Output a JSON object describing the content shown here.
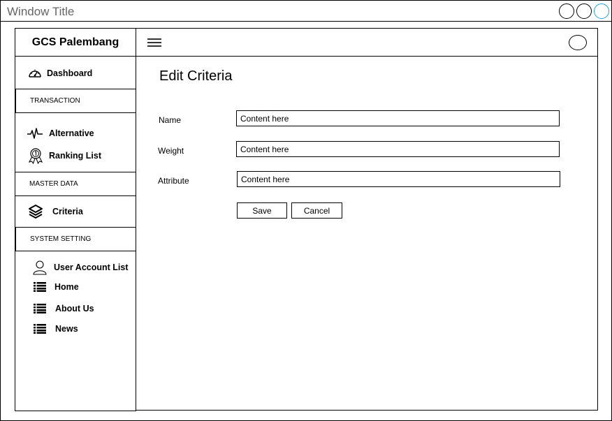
{
  "window": {
    "title": "Window Title"
  },
  "sidebar": {
    "brand": "GCS Palembang",
    "dashboard": {
      "label": "Dashboard",
      "icon": "gauge-icon"
    },
    "sections": {
      "transaction": "TRANSACTION",
      "master_data": "MASTER DATA",
      "system_setting": "SYSTEM SETTING"
    },
    "transaction_items": [
      {
        "label": "Alternative",
        "icon": "pulse-icon"
      },
      {
        "label": "Ranking List",
        "icon": "award-ribbon-icon"
      }
    ],
    "master_items": [
      {
        "label": "Criteria",
        "icon": "layers-icon"
      }
    ],
    "setting_items": [
      {
        "label": "User Account List",
        "icon": "user-icon"
      },
      {
        "label": "Home",
        "icon": "list-icon"
      },
      {
        "label": "About Us",
        "icon": "list-icon"
      },
      {
        "label": "News",
        "icon": "list-icon"
      }
    ]
  },
  "main": {
    "title": "Edit Criteria",
    "form": {
      "name": {
        "label": "Name",
        "value": "Content here"
      },
      "weight": {
        "label": "Weight",
        "value": "Content here"
      },
      "attribute": {
        "label": "Attribute",
        "value": "Content here"
      }
    },
    "save_label": "Save",
    "cancel_label": "Cancel"
  },
  "colors": {
    "accent": "#1ba1e2",
    "title_text": "#666666"
  }
}
